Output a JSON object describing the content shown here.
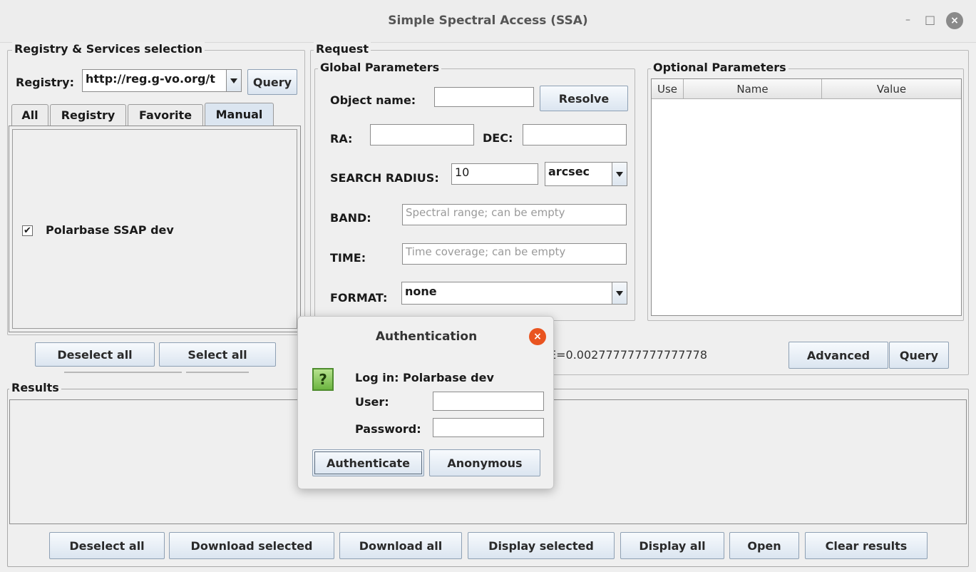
{
  "window": {
    "title": "Simple Spectral Access (SSA)",
    "minimize": "–",
    "maximize": "□",
    "close": "×"
  },
  "registry_panel": {
    "legend": "Registry & Services selection",
    "registry_label": "Registry:",
    "registry_value": "http://reg.g-vo.org/t",
    "query_label": "Query",
    "tabs": [
      "All",
      "Registry",
      "Favorite",
      "Manual"
    ],
    "active_tab": "Manual",
    "services": [
      {
        "label": "Polarbase SSAP dev",
        "checked": true,
        "check_glyph": "✔"
      }
    ],
    "deselect_all": "Deselect all",
    "select_all": "Select all"
  },
  "request": {
    "legend": "Request",
    "global_legend": "Global Parameters",
    "object_name_label": "Object name:",
    "object_name_value": "",
    "resolve_label": "Resolve",
    "ra_label": "RA:",
    "ra_value": "",
    "dec_label": "DEC:",
    "dec_value": "",
    "radius_label": "SEARCH RADIUS:",
    "radius_value": "10",
    "radius_unit": "arcsec",
    "band_label": "BAND:",
    "band_placeholder": "Spectral range; can be empty",
    "time_label": "TIME:",
    "time_placeholder": "Time coverage; can be empty",
    "format_label": "FORMAT:",
    "format_value": "none",
    "optional_legend": "Optional Parameters",
    "optional_columns": [
      "Use",
      "Name",
      "Value"
    ],
    "query_string": "E=0.002777777777777778",
    "advanced_label": "Advanced",
    "query_label": "Query"
  },
  "results": {
    "legend": "Results",
    "buttons": [
      "Deselect all",
      "Download selected",
      "Download all",
      "Display selected",
      "Display all",
      "Open",
      "Clear results"
    ]
  },
  "auth_dialog": {
    "title": "Authentication",
    "icon_glyph": "?",
    "close_glyph": "×",
    "message": "Log in: Polarbase dev",
    "user_label": "User:",
    "user_value": "",
    "password_label": "Password:",
    "password_value": "",
    "authenticate_label": "Authenticate",
    "anonymous_label": "Anonymous"
  },
  "colors": {
    "accent_close": "#e95420",
    "button_border": "#8ea0b4",
    "active_tab": "#dbe5f0"
  }
}
